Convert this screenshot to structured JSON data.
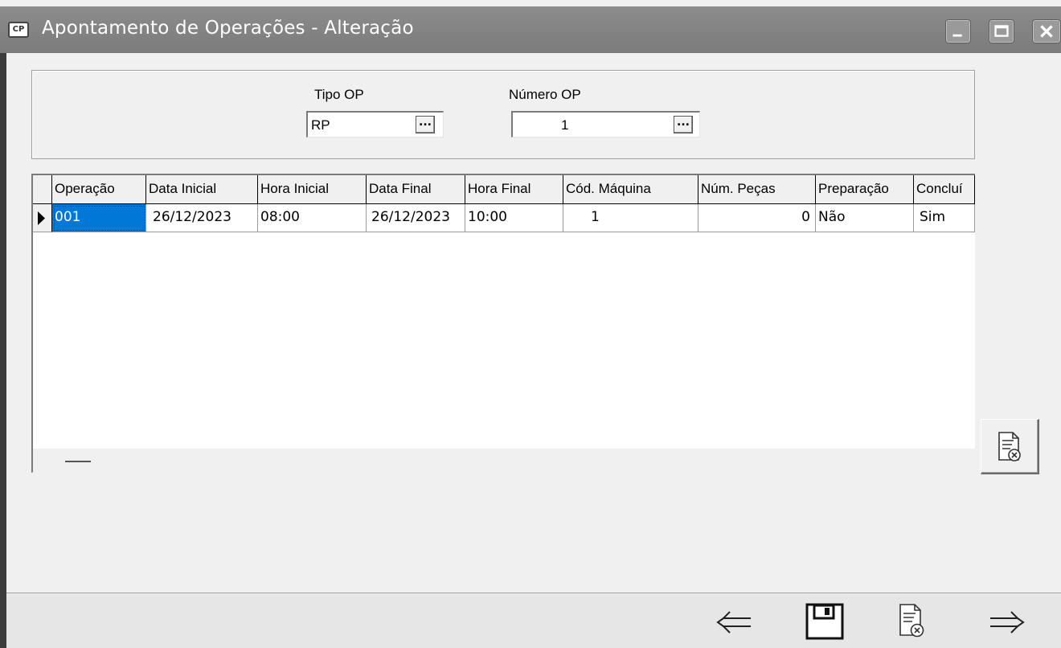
{
  "window": {
    "title": "Apontamento de Operações - Alteração",
    "app_icon_text": "CP",
    "controls": [
      "minimize-icon",
      "maximize-icon",
      "close-icon"
    ]
  },
  "header": {
    "tipo_op_label": "Tipo OP",
    "tipo_op_value": "RP",
    "numero_op_label": "Número OP",
    "numero_op_value": "1",
    "lookup_button_text": "..."
  },
  "grid": {
    "columns": [
      "Operação",
      "Data Inicial",
      "Hora Inicial",
      "Data Final",
      "Hora Final",
      "Cód. Máquina",
      "Núm. Peças",
      "Preparação",
      "Concluí"
    ],
    "rows": [
      [
        "001",
        "26/12/2023",
        "08:00",
        "26/12/2023",
        "10:00",
        "1",
        "0",
        "Não",
        "Sim"
      ]
    ]
  },
  "side_button": {
    "icon": "delete-document-icon"
  },
  "toolbar": {
    "buttons": [
      "previous-arrow-icon",
      "save-disk-icon",
      "delete-document-icon",
      "next-arrow-icon"
    ]
  },
  "colors": {
    "titlebar": "#808080",
    "selection": "#0078d7",
    "background": "#f0f0f0"
  }
}
